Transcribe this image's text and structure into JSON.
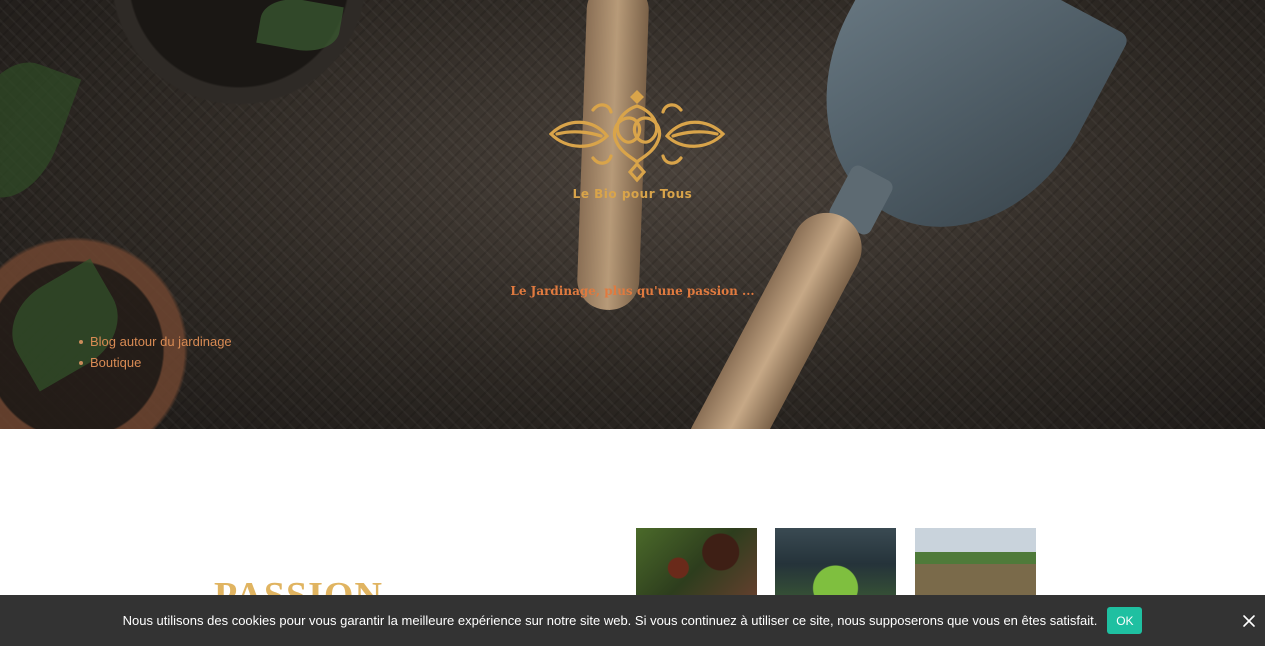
{
  "header": {
    "brand_name": "Le Bio pour Tous",
    "tagline": "Le Jardinage, plus qu'une passion ..."
  },
  "nav": {
    "items": [
      {
        "label": "Blog autour du jardinage"
      },
      {
        "label": "Boutique"
      }
    ]
  },
  "main": {
    "section_heading": "PASSION",
    "thumbnails": [
      {
        "icon": "coffee-harvest-photo"
      },
      {
        "icon": "seedling-planting-photo"
      },
      {
        "icon": "field-farming-photo"
      }
    ]
  },
  "cookie_banner": {
    "message": "Nous utilisons des cookies pour vous garantir la meilleure expérience sur notre site web. Si vous continuez à utiliser ce site, nous supposerons que vous en êtes satisfait.",
    "ok_label": "OK",
    "close_icon": "close-icon"
  },
  "colors": {
    "brand_gold": "#d9a44a",
    "tagline_orange": "#e07a3f",
    "menu_link": "#d98b54",
    "cookie_bg": "#333333",
    "ok_button": "#1fc0a1"
  }
}
